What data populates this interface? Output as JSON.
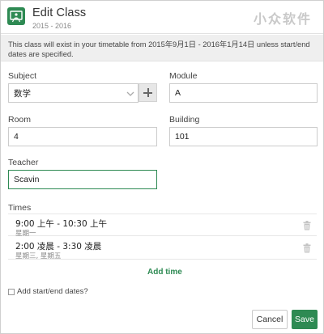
{
  "header": {
    "title": "Edit Class",
    "subtitle": "2015 - 2016",
    "watermark": "小众软件"
  },
  "banner": {
    "text": "This class will exist in your timetable from 2015年9月1日 - 2016年1月14日 unless start/end dates are specified."
  },
  "form": {
    "subject": {
      "label": "Subject",
      "value": "数学"
    },
    "module": {
      "label": "Module",
      "value": "A"
    },
    "room": {
      "label": "Room",
      "value": "4"
    },
    "building": {
      "label": "Building",
      "value": "101"
    },
    "teacher": {
      "label": "Teacher",
      "value": "Scavin"
    }
  },
  "times": {
    "label": "Times",
    "items": [
      {
        "time": "9:00 上午 - 10:30 上午",
        "days": "星期一"
      },
      {
        "time": "2:00 凌晨 - 3:30 凌晨",
        "days": "星期三, 星期五"
      }
    ],
    "add_label": "Add time"
  },
  "dates_checkbox": {
    "label": "Add start/end dates?",
    "checked": false
  },
  "buttons": {
    "cancel": "Cancel",
    "save": "Save"
  },
  "colors": {
    "accent": "#2e8a53"
  }
}
